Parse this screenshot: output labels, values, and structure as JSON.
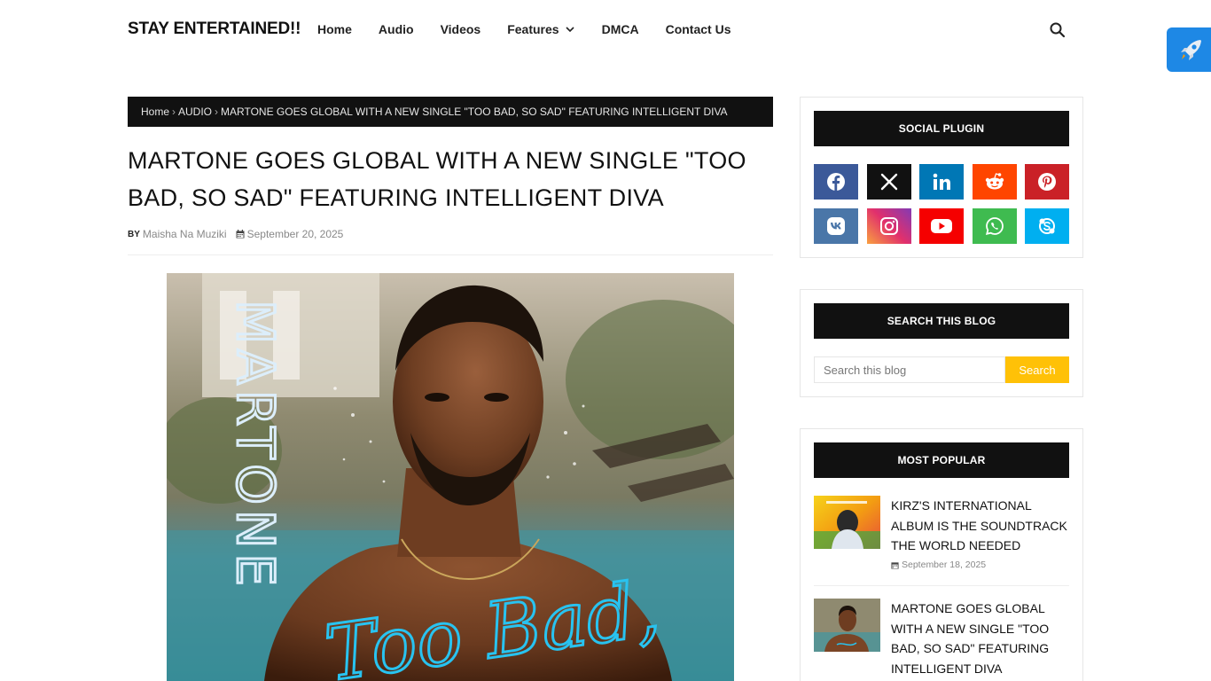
{
  "header": {
    "site_title": "STAY ENTERTAINED!!",
    "nav": [
      {
        "label": "Home"
      },
      {
        "label": "Audio"
      },
      {
        "label": "Videos"
      },
      {
        "label": "Features"
      },
      {
        "label": "DMCA"
      },
      {
        "label": "Contact Us"
      }
    ],
    "search_icon": "search-icon",
    "rocket_icon": "rocket-icon"
  },
  "breadcrumb": {
    "home": "Home",
    "category": "AUDIO",
    "current": "MARTONE GOES GLOBAL WITH A NEW SINGLE \"TOO BAD, SO SAD\" FEATURING INTELLIGENT DIVA"
  },
  "post": {
    "title": "MARTONE GOES GLOBAL WITH A NEW SINGLE \"TOO BAD, SO SAD\" FEATURING INTELLIGENT DIVA",
    "by_label": "BY",
    "author": "Maisha Na Muziki",
    "date": "September 20, 2025",
    "image": {
      "artist_text": "MARTONE",
      "script_text": "Too Bad,"
    }
  },
  "sidebar": {
    "social": {
      "title": "SOCIAL PLUGIN",
      "icons": [
        {
          "name": "facebook-icon",
          "color": "#3b5999"
        },
        {
          "name": "x-twitter-icon",
          "color": "#111111"
        },
        {
          "name": "linkedin-icon",
          "color": "#0077b5"
        },
        {
          "name": "reddit-icon",
          "color": "#ff4500"
        },
        {
          "name": "pinterest-icon",
          "color": "#ca2127"
        },
        {
          "name": "vk-icon",
          "color": "#4a76a8"
        },
        {
          "name": "instagram-icon",
          "color": "#c13584"
        },
        {
          "name": "youtube-icon",
          "color": "#f50000"
        },
        {
          "name": "whatsapp-icon",
          "color": "#3fbb50"
        },
        {
          "name": "skype-icon",
          "color": "#00aff0"
        }
      ]
    },
    "search": {
      "title": "SEARCH THIS BLOG",
      "placeholder": "Search this blog",
      "button": "Search"
    },
    "popular": {
      "title": "MOST POPULAR",
      "items": [
        {
          "title": "KIRZ'S INTERNATIONAL ALBUM IS THE SOUNDTRACK THE WORLD NEEDED",
          "date": "September 18, 2025"
        },
        {
          "title": "MARTONE GOES GLOBAL WITH A NEW SINGLE \"TOO BAD, SO SAD\" FEATURING INTELLIGENT DIVA",
          "date": ""
        }
      ]
    }
  },
  "colors": {
    "accent": "#ffc107",
    "dark": "#111111",
    "rocket": "#1e88e5"
  }
}
